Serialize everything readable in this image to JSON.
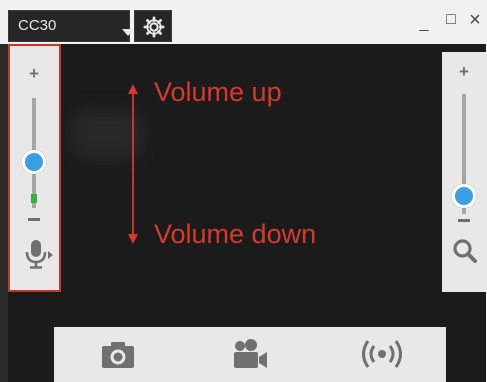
{
  "window": {
    "device_name": "CC30",
    "controls": {
      "minimize": "_",
      "maximize": "□",
      "close": "×"
    }
  },
  "left_panel": {
    "plus_label": "+",
    "minus_label": "−",
    "volume_level": 0.42,
    "icons": [
      "microphone-icon",
      "small-play-arrow-icon"
    ]
  },
  "right_panel": {
    "plus_label": "+",
    "minus_label": "−",
    "zoom_level": 0.15,
    "icons": [
      "search-icon"
    ]
  },
  "annotations": {
    "volume_up": "Volume up",
    "volume_down": "Volume down"
  },
  "bottom_bar": {
    "icons": [
      "camera-icon",
      "video-camera-icon",
      "broadcast-icon"
    ]
  },
  "colors": {
    "accent": "#3aa0e2",
    "annotation": "#d63a2f",
    "level_meter": "#33b23a",
    "viewport": "#1b1b1b"
  }
}
